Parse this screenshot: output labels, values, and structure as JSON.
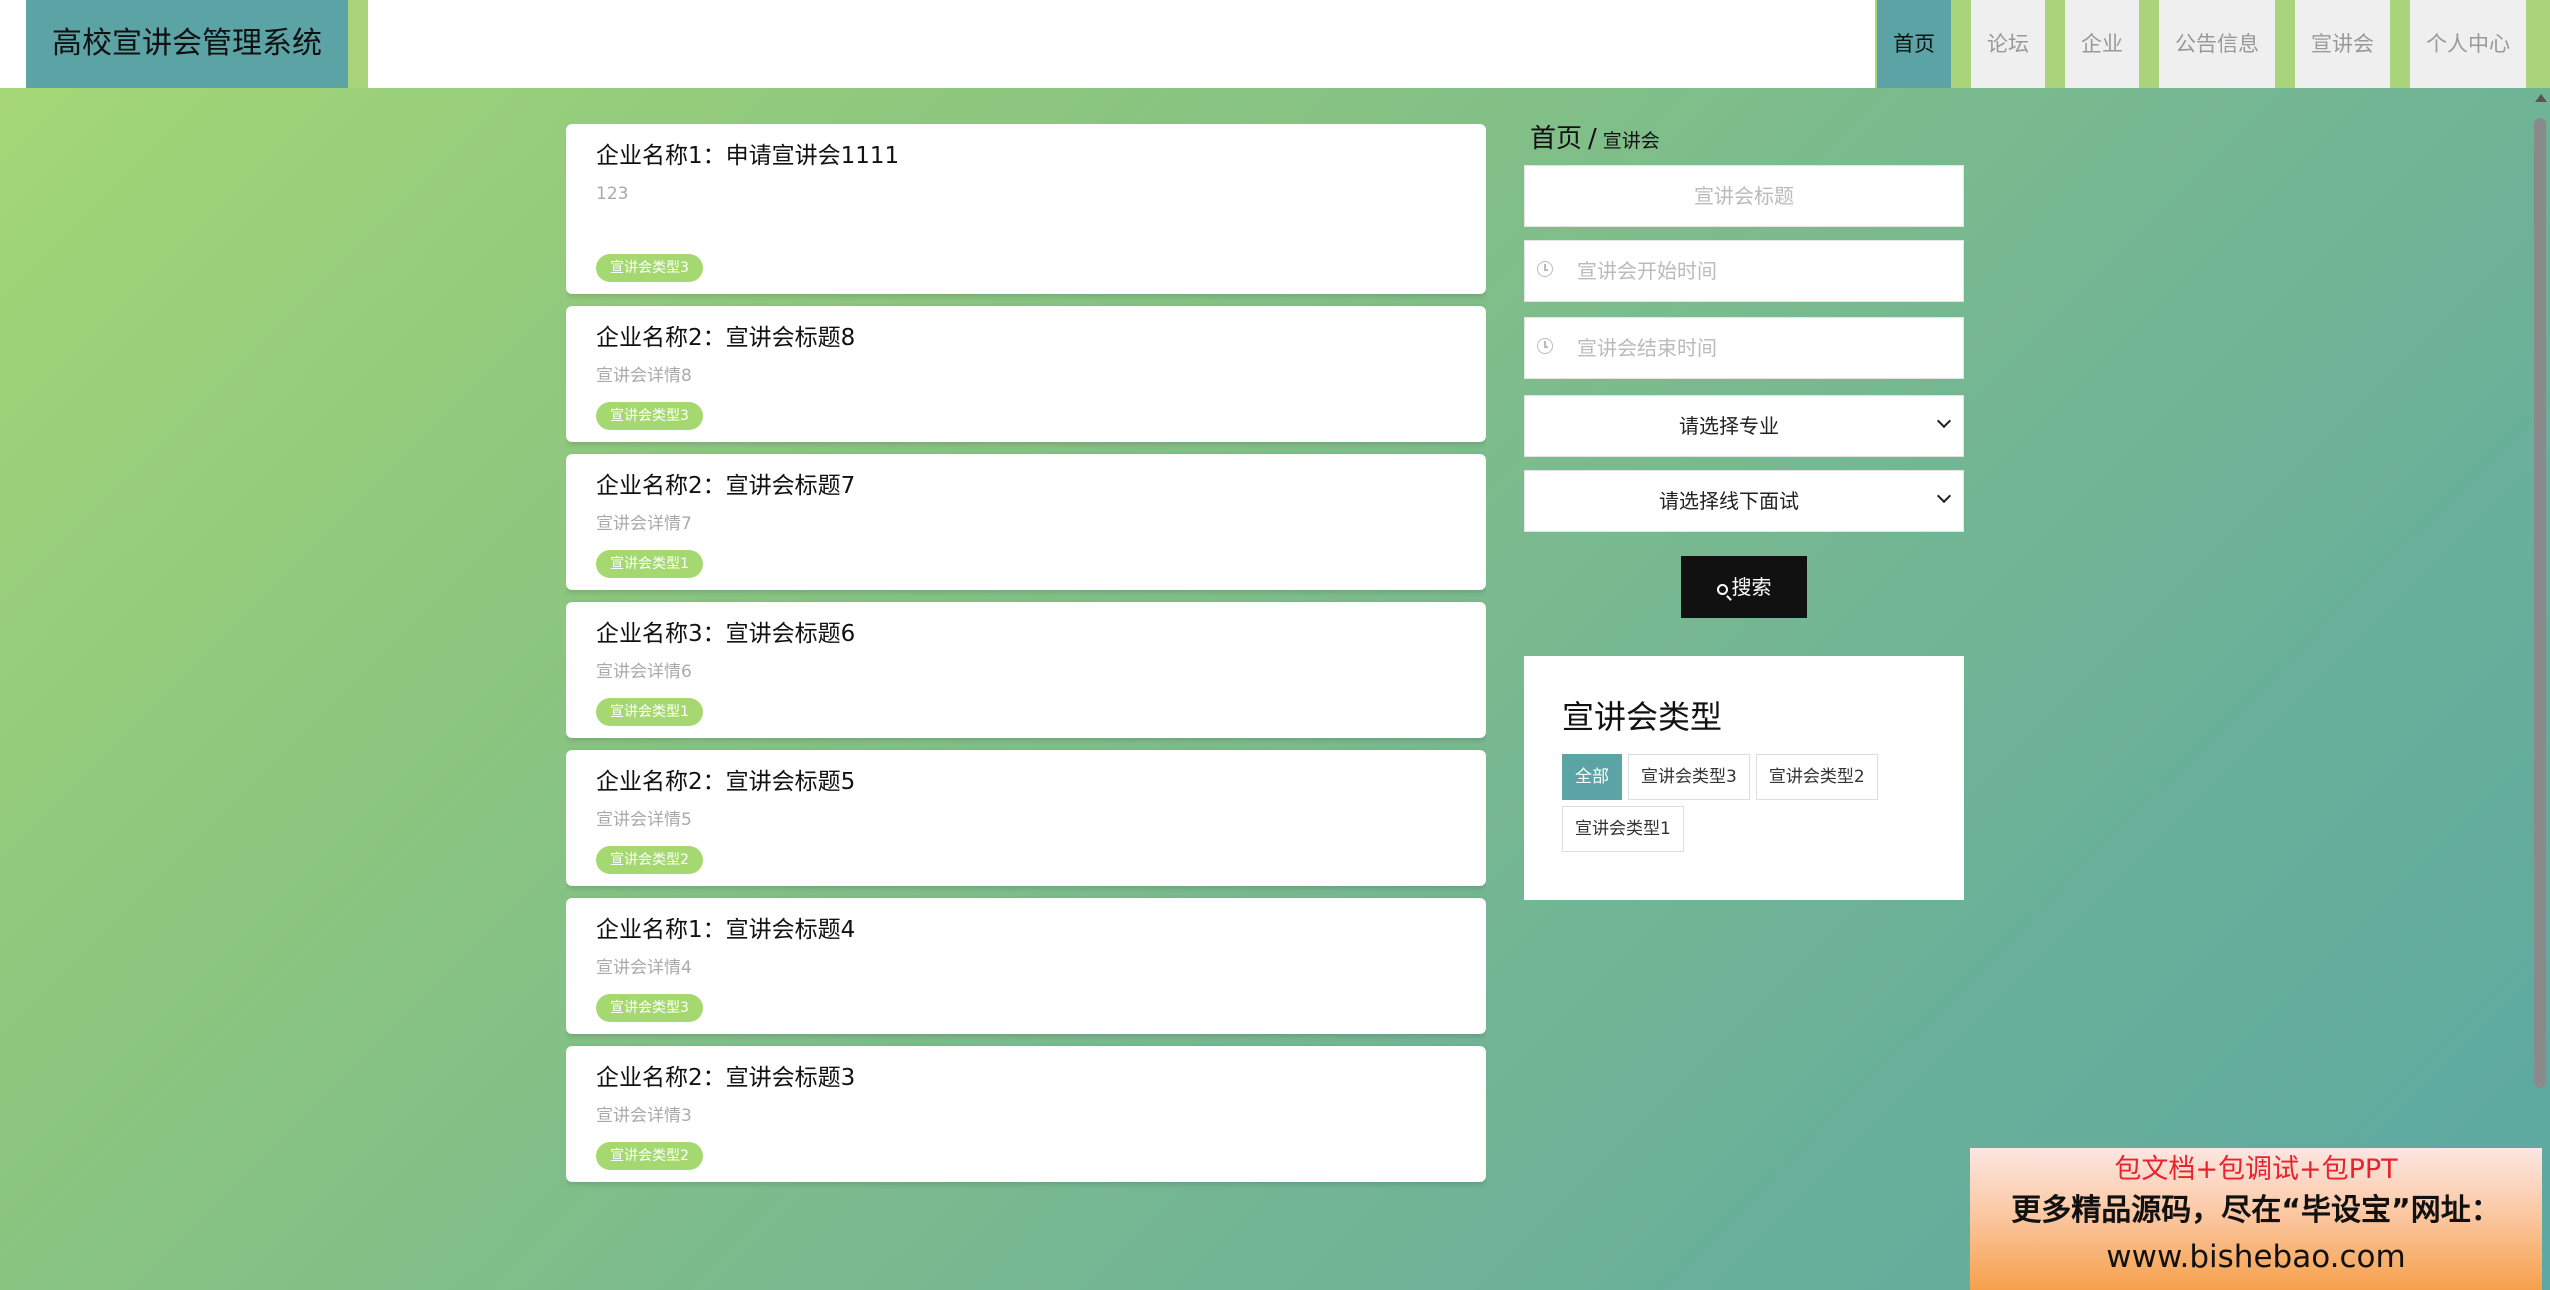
{
  "header": {
    "title": "高校宣讲会管理系统",
    "nav": [
      "首页",
      "论坛",
      "企业",
      "公告信息",
      "宣讲会",
      "个人中心"
    ],
    "active_nav": "首页"
  },
  "breadcrumb": {
    "home": "首页",
    "separator": "/",
    "current": "宣讲会"
  },
  "filters": {
    "title_placeholder": "宣讲会标题",
    "start_placeholder": "宣讲会开始时间",
    "end_placeholder": "宣讲会结束时间",
    "major_select": "请选择专业",
    "interview_select": "请选择线下面试",
    "search_label": "搜索"
  },
  "type_panel": {
    "title": "宣讲会类型",
    "tags": [
      "全部",
      "宣讲会类型3",
      "宣讲会类型2",
      "宣讲会类型1"
    ],
    "active_tag": "全部"
  },
  "list": [
    {
      "title": "企业名称1：申请宣讲会1111",
      "detail": "123",
      "tag": "宣讲会类型3"
    },
    {
      "title": "企业名称2：宣讲会标题8",
      "detail": "宣讲会详情8",
      "tag": "宣讲会类型3"
    },
    {
      "title": "企业名称2：宣讲会标题7",
      "detail": "宣讲会详情7",
      "tag": "宣讲会类型1"
    },
    {
      "title": "企业名称3：宣讲会标题6",
      "detail": "宣讲会详情6",
      "tag": "宣讲会类型1"
    },
    {
      "title": "企业名称2：宣讲会标题5",
      "detail": "宣讲会详情5",
      "tag": "宣讲会类型2"
    },
    {
      "title": "企业名称1：宣讲会标题4",
      "detail": "宣讲会详情4",
      "tag": "宣讲会类型3"
    },
    {
      "title": "企业名称2：宣讲会标题3",
      "detail": "宣讲会详情3",
      "tag": "宣讲会类型2"
    }
  ],
  "ad": {
    "line1": "包文档+包调试+包PPT",
    "line2": "更多精品源码，尽在“毕设宝”网址：",
    "line3": "www.bishebao.com"
  },
  "colors": {
    "brand": "#5ba3a4",
    "tag_green": "#a6d872",
    "ad_red": "#e8232f"
  }
}
